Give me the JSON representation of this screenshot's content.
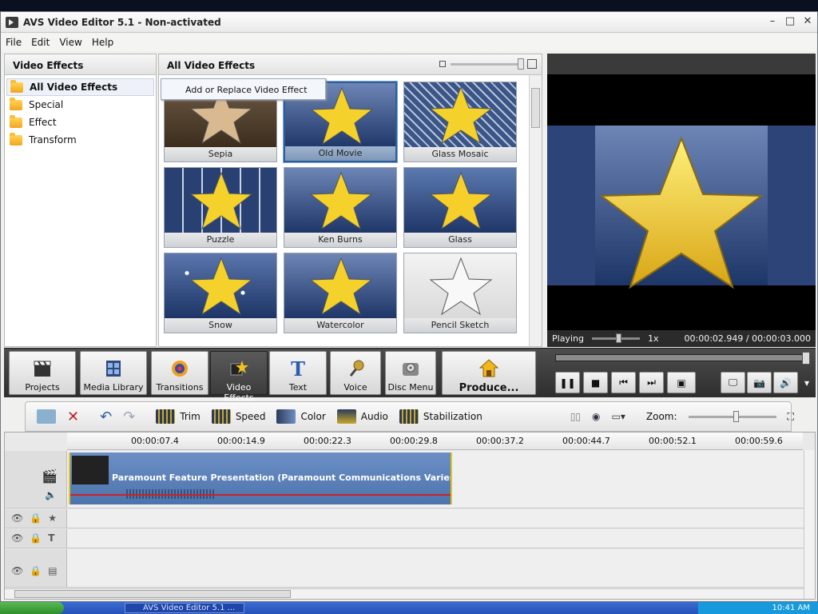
{
  "window": {
    "title": "AVS Video Editor 5.1 - Non-activated",
    "min": "–",
    "max": "□",
    "close": "✕"
  },
  "menu": [
    "File",
    "Edit",
    "View",
    "Help"
  ],
  "left_panel": {
    "header": "Video Effects",
    "items": [
      {
        "label": "All Video Effects",
        "selected": true
      },
      {
        "label": "Special"
      },
      {
        "label": "Effect"
      },
      {
        "label": "Transform"
      }
    ]
  },
  "mid_panel": {
    "header": "All Video Effects",
    "tooltip": "Add or Replace Video Effect",
    "tiles": [
      {
        "label": "Sepia",
        "style": "sepia"
      },
      {
        "label": "Old Movie",
        "style": "blue",
        "selected": true
      },
      {
        "label": "Glass Mosaic",
        "style": "mosaic"
      },
      {
        "label": "Puzzle",
        "style": "puzzle"
      },
      {
        "label": "Ken Burns",
        "style": "blue"
      },
      {
        "label": "Glass",
        "style": "glass"
      },
      {
        "label": "Snow",
        "style": "snow"
      },
      {
        "label": "Watercolor",
        "style": "blue"
      },
      {
        "label": "Pencil Sketch",
        "style": "sketch"
      }
    ]
  },
  "preview": {
    "state": "Playing",
    "speed": "1x",
    "time": "00:00:02.949  /  00:00:03.000"
  },
  "big_toolbar": [
    {
      "label": "Projects",
      "icon": "clapper-icon"
    },
    {
      "label": "Media Library",
      "icon": "film-icon"
    },
    {
      "label": "Transitions",
      "icon": "swirl-icon"
    },
    {
      "label": "Video Effects",
      "icon": "star-effects-icon",
      "active": true
    },
    {
      "label": "Text",
      "icon": "text-t-icon"
    },
    {
      "label": "Voice",
      "icon": "microphone-icon"
    },
    {
      "label": "Disc Menu",
      "icon": "disc-icon"
    },
    {
      "label": "Produce...",
      "icon": "house-icon"
    }
  ],
  "playback": {
    "progress": 0.99
  },
  "edit_toolbar": {
    "trim": "Trim",
    "speed": "Speed",
    "color": "Color",
    "audio": "Audio",
    "stabilization": "Stabilization",
    "zoom": "Zoom:"
  },
  "timeline": {
    "ticks": [
      "00:00:07.4",
      "00:00:14.9",
      "00:00:22.3",
      "00:00:29.8",
      "00:00:37.2",
      "00:00:44.7",
      "00:00:52.1",
      "00:00:59.6"
    ],
    "clip_title": "Paramount Feature Presentation (Paramount Communications Varient)...."
  },
  "taskbar": {
    "app": "AVS Video Editor 5.1 ...",
    "clock": "10:41 AM"
  },
  "colors": {
    "accent": "#2d5e9c",
    "clip": "#5a80b9",
    "dark_bar": "#3a3a3a"
  }
}
